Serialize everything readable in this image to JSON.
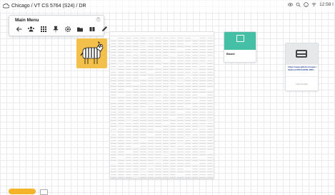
{
  "header": {
    "breadcrumb": "Chicago / VT CS 5764 (S24) / DR",
    "time": "12:58 I"
  },
  "menu": {
    "title": "Main Menu",
    "icons": [
      "arrow-left-icon",
      "users-icon",
      "grid-icon",
      "pin-icon",
      "settings-icon",
      "folder-icon",
      "book-icon",
      "pencil-icon"
    ]
  },
  "note": {
    "caption": "",
    "title": "Board",
    "subtitle": ""
  },
  "link_card": {
    "url": "https://vega.github.io/vega-lite/docs/35416-8000-4000...",
    "footer": "Link preview"
  },
  "colors": {
    "accent": "#45c0a6",
    "sticky": "#f3c04b",
    "pill": "#f4b429"
  }
}
